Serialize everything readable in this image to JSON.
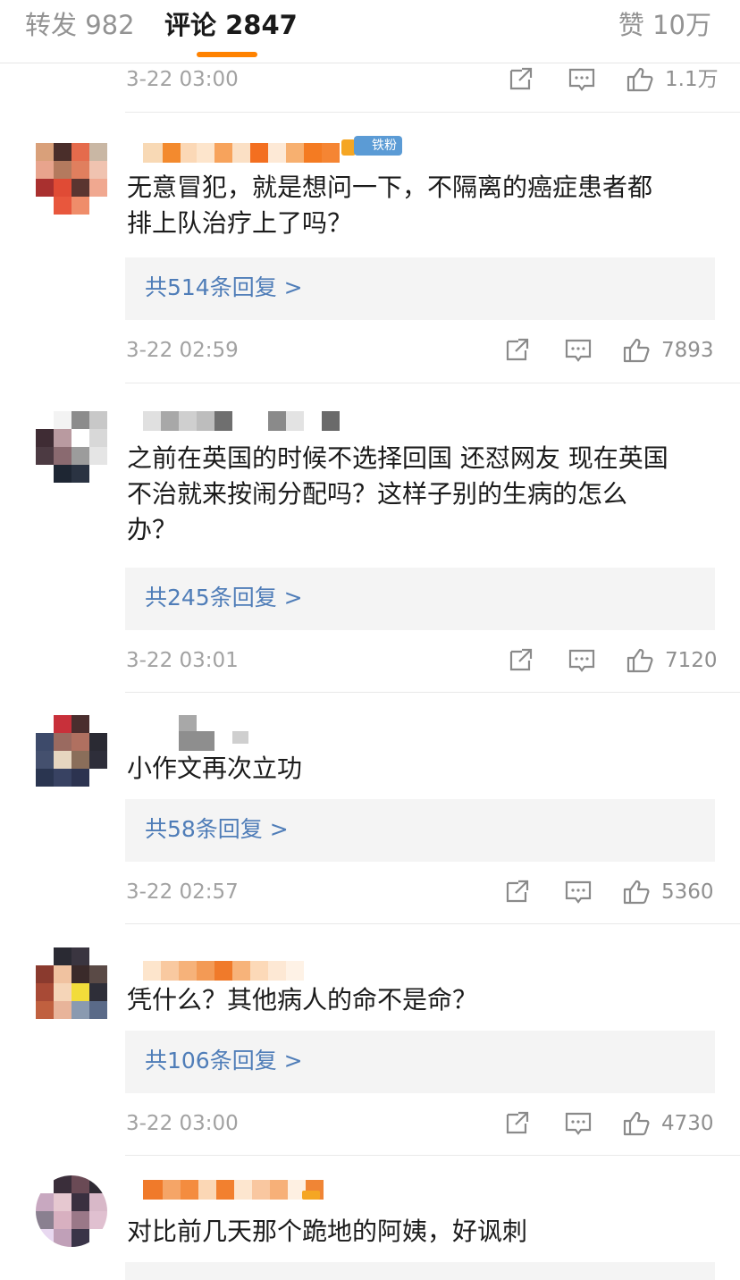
{
  "header": {
    "repost_label": "转发 982",
    "comment_label": "评论 2847",
    "like_label": "赞 10万",
    "accent_color": "#ff8200"
  },
  "top_meta": {
    "time": "3-22 03:00",
    "likes": "1.1万"
  },
  "comments": [
    {
      "badge": "铁粉",
      "text_lines": [
        "无意冒犯，就是想问一下，不隔离的癌症患者都",
        "排上队治疗上了吗？"
      ],
      "replies": "共514条回复 >",
      "time": "3-22 02:59",
      "likes": "7893"
    },
    {
      "text_lines": [
        "之前在英国的时候不选择回国 还怼网友 现在英国",
        "不治就来按闹分配吗？这样子别的生病的怎么",
        "办？"
      ],
      "replies": "共245条回复 >",
      "time": "3-22 03:01",
      "likes": "7120"
    },
    {
      "text_lines": [
        "小作文再次立功"
      ],
      "replies": "共58条回复 >",
      "time": "3-22 02:57",
      "likes": "5360"
    },
    {
      "text_lines": [
        "凭什么？其他病人的命不是命？"
      ],
      "replies": "共106条回复 >",
      "time": "3-22 03:00",
      "likes": "4730"
    },
    {
      "text_lines": [
        "对比前几天那个跪地的阿姨，好讽刺"
      ]
    }
  ],
  "icons": {
    "share": "share-icon",
    "comment": "comment-icon",
    "like": "thumb-up-icon",
    "fan_badge": "fan-badge-icon"
  }
}
